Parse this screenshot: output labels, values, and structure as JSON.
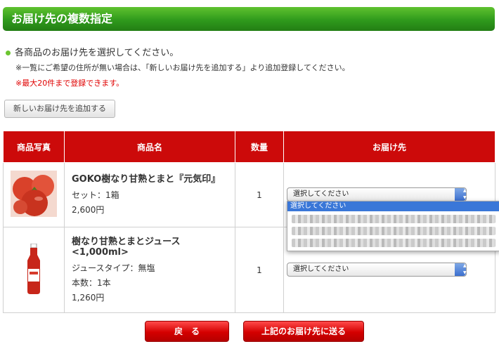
{
  "header": {
    "title": "お届け先の複数指定"
  },
  "instructions": {
    "main": "各商品のお届け先を選択してください。",
    "note1": "※一覧にご希望の住所が無い場合は、「新しいお届け先を追加する」より追加登録してください。",
    "note2": "※最大20件まで登録できます。"
  },
  "buttons": {
    "add_new": "新しいお届け先を追加する",
    "back": "戻　る",
    "send": "上記のお届け先に送る"
  },
  "table": {
    "headers": [
      "商品写真",
      "商品名",
      "数量",
      "お届け先"
    ],
    "rows": [
      {
        "name": "GOKO樹なり甘熟とまと『元気印』",
        "lines": [
          "セット：1箱",
          "2,600円"
        ],
        "qty": "1",
        "destination": "選択してください"
      },
      {
        "name": "樹なり甘熟とまとジュース<1,000ml>",
        "lines": [
          "ジュースタイプ：無塩",
          "本数：1本",
          "1,260円"
        ],
        "qty": "1",
        "destination": "選択してください"
      }
    ]
  },
  "dropdown": {
    "selected_option": "選択してください"
  },
  "colors": {
    "header_green": "#2f9a1c",
    "table_header_red": "#cc0a0a",
    "note_red": "#e00000"
  }
}
